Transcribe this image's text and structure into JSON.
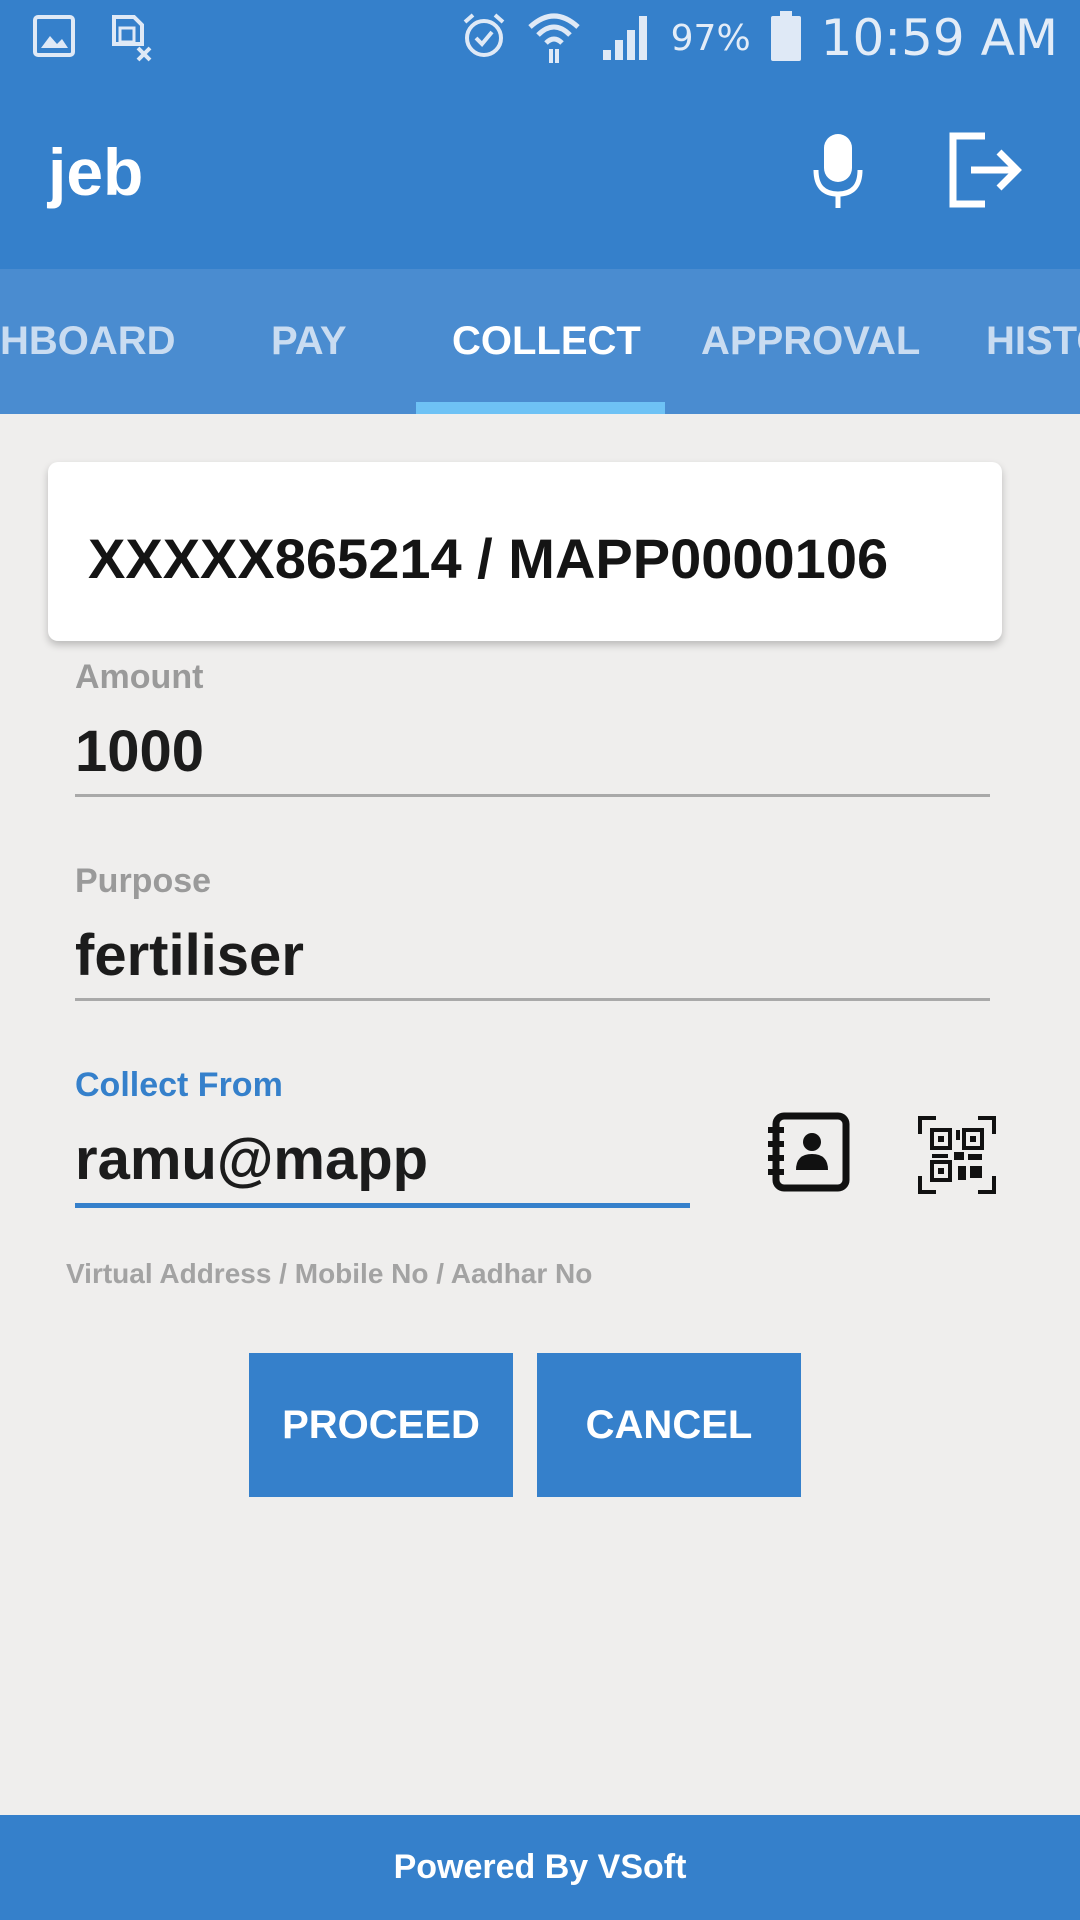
{
  "status_bar": {
    "battery": "97%",
    "time": "10:59 AM",
    "icons": [
      "gallery-icon",
      "sim-blocked-icon",
      "alarm-icon",
      "wifi-icon",
      "signal-icon",
      "battery-icon"
    ]
  },
  "app_bar": {
    "title": "jeb",
    "icons": [
      "microphone-icon",
      "logout-icon"
    ]
  },
  "tabs": [
    {
      "label": "DASHBOARD",
      "visible_label": "HBOARD",
      "active": false
    },
    {
      "label": "PAY",
      "active": false
    },
    {
      "label": "COLLECT",
      "active": true
    },
    {
      "label": "APPROVAL",
      "active": false
    },
    {
      "label": "HISTORY",
      "visible_label": "HISTO",
      "active": false
    }
  ],
  "account": {
    "display": "XXXXX865214 / MAPP0000106"
  },
  "form": {
    "amount": {
      "label": "Amount",
      "value": "1000"
    },
    "purpose": {
      "label": "Purpose",
      "value": "fertiliser"
    },
    "collect_from": {
      "label": "Collect From",
      "value": "ramu@mapp",
      "hint": "Virtual Address / Mobile No / Aadhar No"
    }
  },
  "buttons": {
    "proceed": "PROCEED",
    "cancel": "CANCEL"
  },
  "footer": {
    "text": "Powered By VSoft"
  },
  "colors": {
    "primary": "#3580cb",
    "tab_bar": "#4a8cd0",
    "indicator": "#6ec2f5",
    "background": "#efeeed"
  }
}
